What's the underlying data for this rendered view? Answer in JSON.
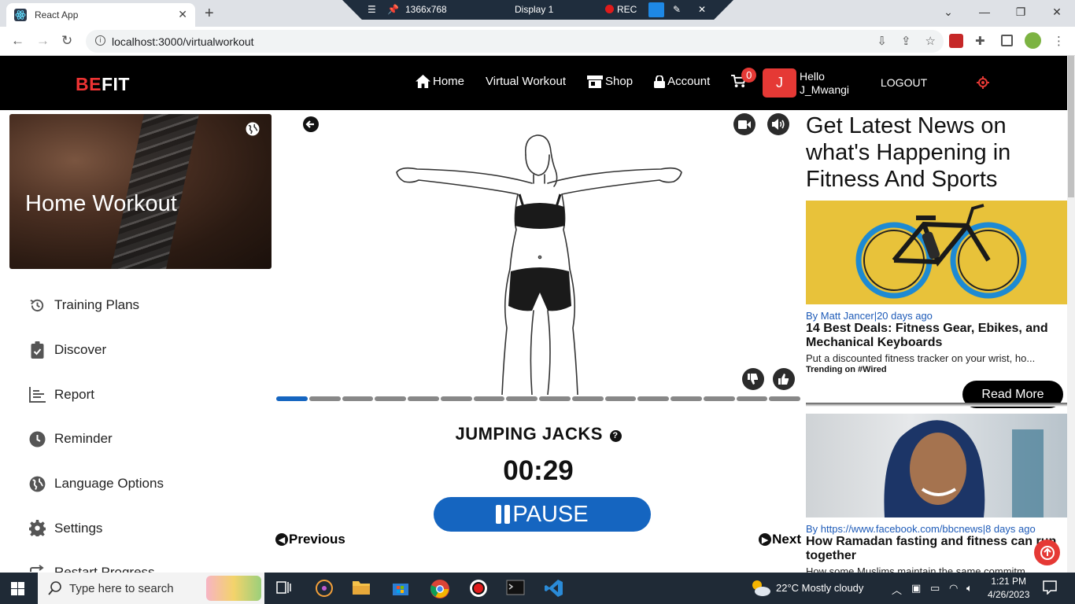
{
  "browser": {
    "tab_title": "React App",
    "url": "localhost:3000/virtualworkout",
    "recorder": {
      "resolution": "1366x768",
      "display": "Display 1",
      "rec_label": "REC"
    }
  },
  "navbar": {
    "logo_be": "BE",
    "logo_fit": "FIT",
    "links": {
      "home": "Home",
      "virtual": "Virtual Workout",
      "shop": "Shop",
      "account": "Account"
    },
    "cart_count": "0",
    "avatar_initial": "J",
    "hello_line1": "Hello",
    "hello_line2": "J_Mwangi",
    "logout": "LOGOUT"
  },
  "sidebar": {
    "hero_title": "Home Workout",
    "items": [
      {
        "label": "Training Plans",
        "icon": "history-icon"
      },
      {
        "label": "Discover",
        "icon": "clipboard-icon"
      },
      {
        "label": "Report",
        "icon": "bar-chart-icon"
      },
      {
        "label": "Reminder",
        "icon": "clock-icon"
      },
      {
        "label": "Language Options",
        "icon": "globe-icon"
      },
      {
        "label": "Settings",
        "icon": "gear-icon"
      },
      {
        "label": "Restart Progress",
        "icon": "repeat-icon"
      }
    ]
  },
  "workout": {
    "exercise_name": "JUMPING JACKS",
    "timer": "00:29",
    "pause_label": "PAUSE",
    "prev_label": "Previous",
    "next_label": "Next",
    "progress": {
      "total_steps": 16,
      "current_step": 1
    }
  },
  "news": {
    "heading": "Get Latest News on what's Happening in Fitness And Sports",
    "articles": [
      {
        "meta": "By Matt Jancer|20 days ago",
        "title": "14 Best Deals: Fitness Gear, Ebikes, and Mechanical Keyboards",
        "desc": "Put a discounted fitness tracker on your wrist, ho...",
        "tag": "Trending on #Wired",
        "read_more": "Read More"
      },
      {
        "meta": "By https://www.facebook.com/bbcnews|8 days ago",
        "title": "How Ramadan fasting and fitness can run together",
        "desc": "How some Muslims maintain the same commitm..."
      }
    ]
  },
  "taskbar": {
    "search_placeholder": "Type here to search",
    "weather": "22°C  Mostly cloudy",
    "time": "1:21 PM",
    "date": "4/26/2023"
  },
  "colors": {
    "accent_red": "#e53935",
    "primary_blue": "#1565c0",
    "navbar_bg": "#000000"
  }
}
